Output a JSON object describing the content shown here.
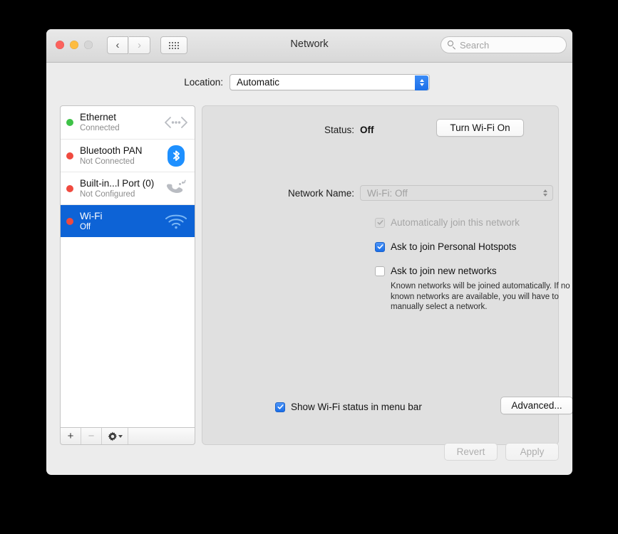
{
  "window": {
    "title": "Network",
    "traffic_lights": [
      "close",
      "minimize",
      "zoom"
    ],
    "nav": {
      "back": "‹",
      "forward": "›",
      "grid": "grid-icon"
    },
    "search": {
      "placeholder": "Search",
      "value": ""
    }
  },
  "location": {
    "label": "Location:",
    "value": "Automatic"
  },
  "sidebar": {
    "services": [
      {
        "name": "Ethernet",
        "status": "Connected",
        "dot": "green",
        "icon": "ethernet-icon",
        "selected": false
      },
      {
        "name": "Bluetooth PAN",
        "status": "Not Connected",
        "dot": "red",
        "icon": "bluetooth-icon",
        "selected": false
      },
      {
        "name": "Built-in...l Port (0)",
        "status": "Not Configured",
        "dot": "red",
        "icon": "serial-port-icon",
        "selected": false
      },
      {
        "name": "Wi-Fi",
        "status": "Off",
        "dot": "red",
        "icon": "wifi-icon",
        "selected": true
      }
    ],
    "toolbar": {
      "add": "+",
      "remove": "−",
      "action": "gear-icon"
    }
  },
  "panel": {
    "status_label": "Status:",
    "status_value": "Off",
    "turn_on_button": "Turn Wi-Fi On",
    "network_name_label": "Network Name:",
    "network_name_value": "Wi-Fi: Off",
    "checkboxes": [
      {
        "label": "Automatically join this network",
        "state": "checked-disabled"
      },
      {
        "label": "Ask to join Personal Hotspots",
        "state": "checked"
      },
      {
        "label": "Ask to join new networks",
        "state": "unchecked"
      }
    ],
    "help_text": "Known networks will be joined automatically. If no known networks are available, you will have to manually select a network.",
    "menubar_checkbox": {
      "label": "Show Wi-Fi status in menu bar",
      "state": "checked"
    },
    "advanced_button": "Advanced...",
    "help_button": "?"
  },
  "footer": {
    "revert": "Revert",
    "apply": "Apply"
  },
  "colors": {
    "selection_blue": "#0d63d6",
    "accent_blue": "#1a6ee8",
    "status_green": "#3ec247",
    "status_red": "#f04a3f"
  }
}
